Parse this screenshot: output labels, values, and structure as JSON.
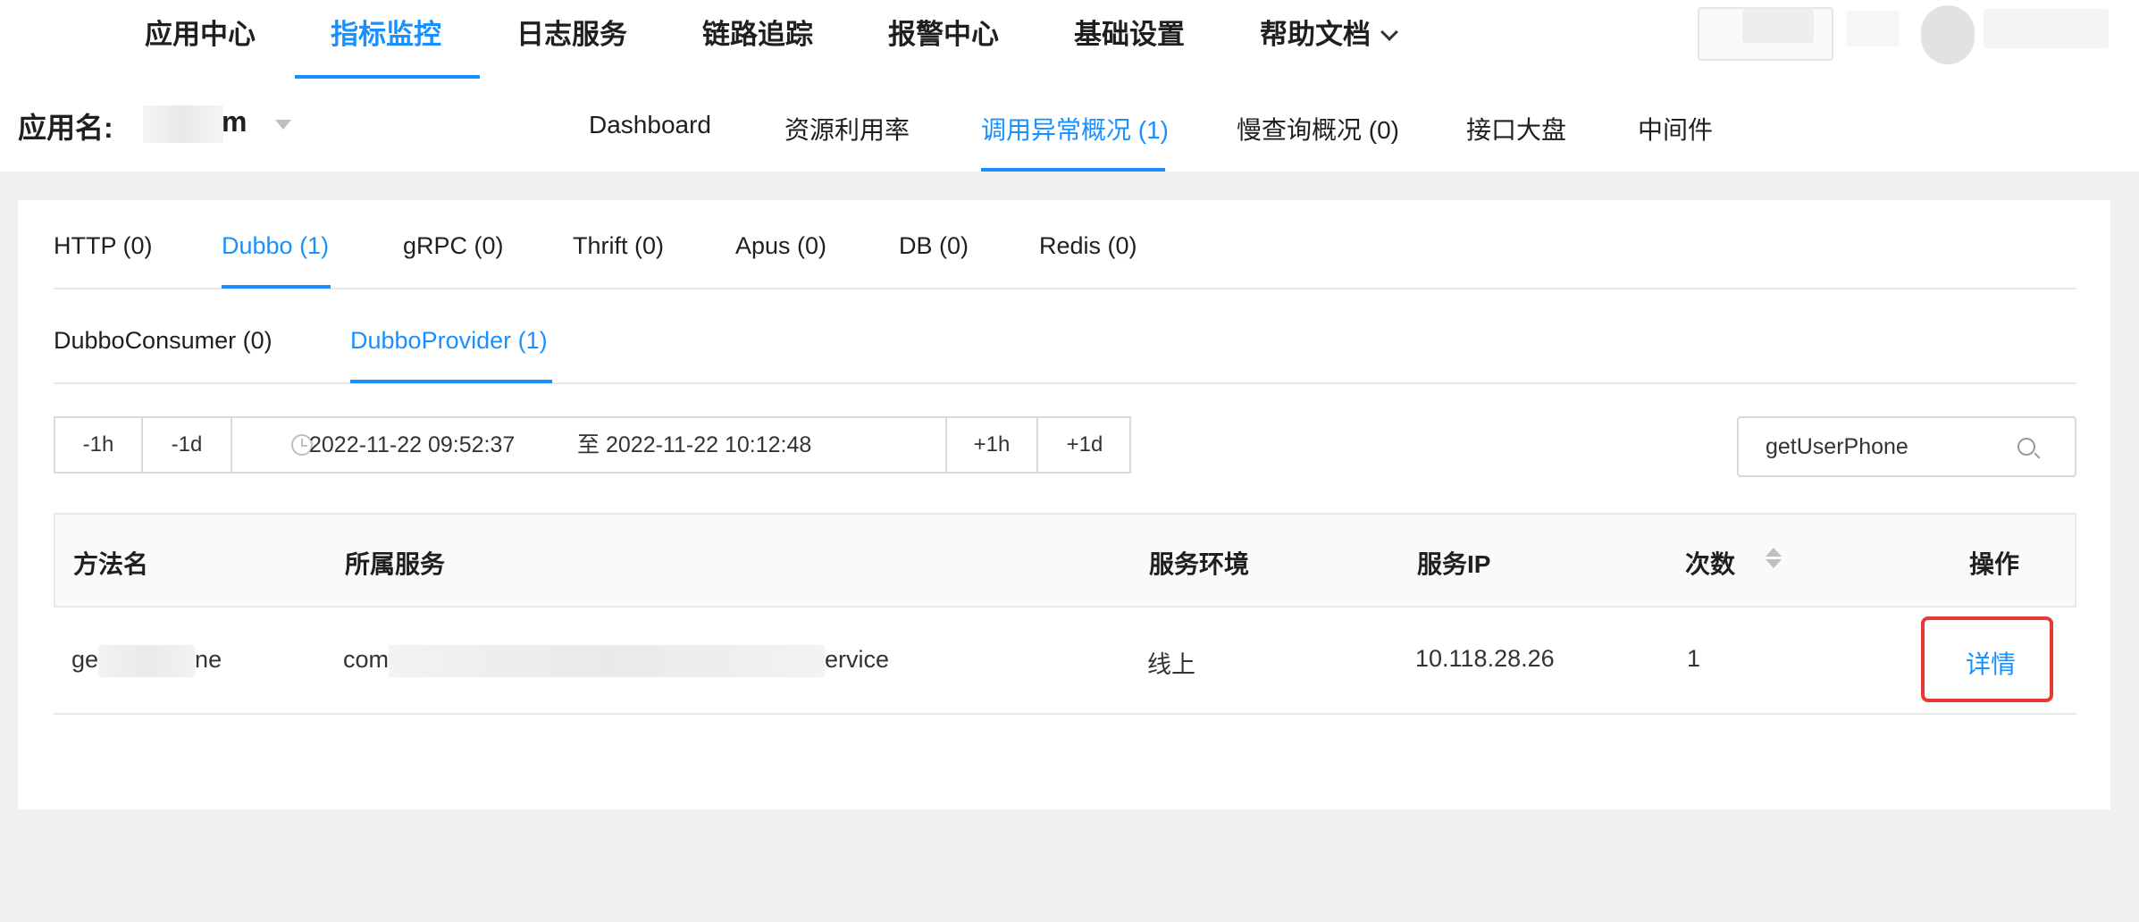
{
  "top_nav": {
    "items": [
      "应用中心",
      "指标监控",
      "日志服务",
      "链路追踪",
      "报警中心",
      "基础设置",
      "帮助文档"
    ],
    "active": "指标监控"
  },
  "sub_bar": {
    "app_label": "应用名:",
    "app_name_visible": "m",
    "tabs": [
      "Dashboard",
      "资源利用率",
      "调用异常概况 (1)",
      "慢查询概况 (0)",
      "接口大盘",
      "中间件"
    ],
    "active_tab": "调用异常概况 (1)"
  },
  "protocol_tabs": {
    "items": [
      "HTTP (0)",
      "Dubbo (1)",
      "gRPC (0)",
      "Thrift (0)",
      "Apus (0)",
      "DB (0)",
      "Redis (0)"
    ],
    "active": "Dubbo (1)"
  },
  "dubbo_tabs": {
    "items": [
      "DubboConsumer (0)",
      "DubboProvider (1)"
    ],
    "active": "DubboProvider (1)"
  },
  "time_range": {
    "minus_1h": "-1h",
    "minus_1d": "-1d",
    "start": "2022-11-22 09:52:37",
    "separator": "至",
    "end": "2022-11-22 10:12:48",
    "plus_1h": "+1h",
    "plus_1d": "+1d"
  },
  "search": {
    "value": "getUserPhone"
  },
  "table": {
    "columns": [
      "方法名",
      "所属服务",
      "服务环境",
      "服务IP",
      "次数",
      "操作"
    ],
    "rows": [
      {
        "method_prefix": "ge",
        "method_suffix": "ne",
        "service_prefix": "com",
        "service_suffix": "ervice",
        "env": "线上",
        "ip": "10.118.28.26",
        "count": "1",
        "action": "详情"
      }
    ]
  },
  "colors": {
    "accent": "#1890ff",
    "highlight_box": "#e53935",
    "background": "#f0f0f0"
  }
}
